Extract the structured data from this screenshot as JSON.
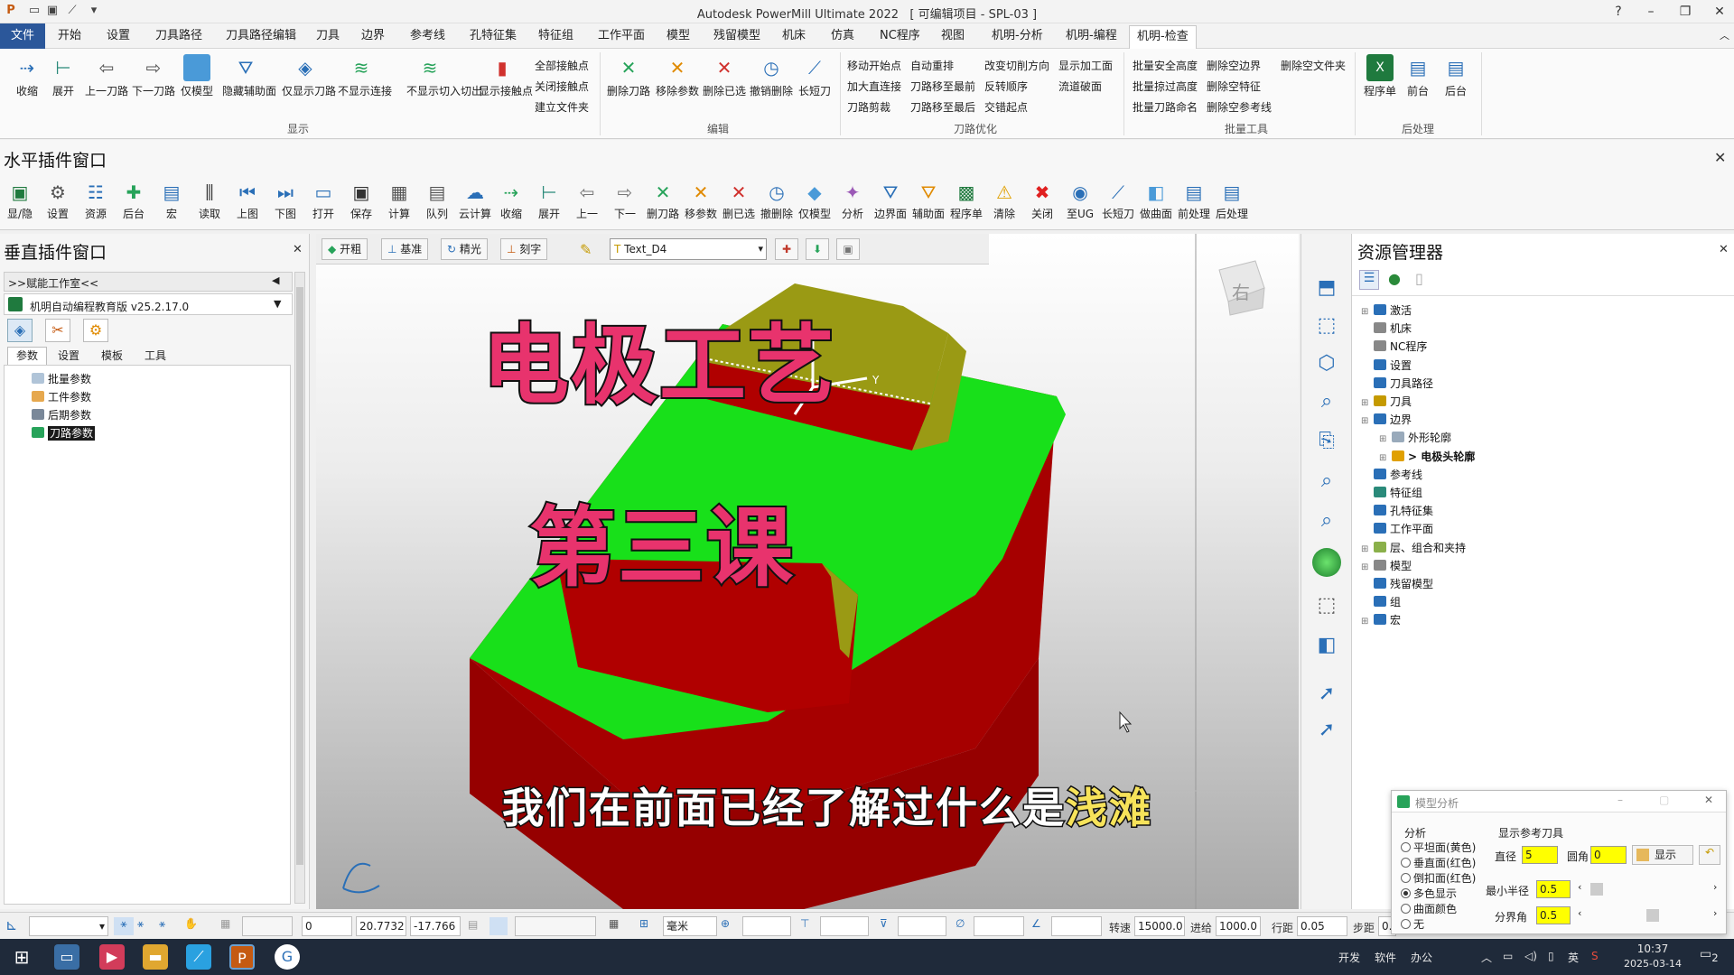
{
  "app": {
    "title": "Autodesk PowerMill Ultimate 2022",
    "project": "[ 可编辑项目 - SPL-03 ]"
  },
  "menu": [
    "文件",
    "开始",
    "设置",
    "刀具路径",
    "刀具路径编辑",
    "刀具",
    "边界",
    "参考线",
    "孔特征集",
    "特征组",
    "工作平面",
    "模型",
    "残留模型",
    "机床",
    "NC程序",
    "仿真",
    "视图",
    "机明-分析",
    "机明-编程",
    "机明-检查"
  ],
  "ribbon": {
    "display_buttons": [
      "收缩",
      "展开",
      "上一刀路",
      "下一刀路",
      "仅模型",
      "隐藏辅助面",
      "仅显示刀路",
      "不显示连接",
      "不显示切入切出",
      "显示接触点"
    ],
    "display_small": [
      "全部接触点",
      "关闭接触点",
      "建立文件夹"
    ],
    "edit_buttons": [
      "删除刀路",
      "移除参数",
      "删除已选",
      "撤销删除",
      "长短刀"
    ],
    "optimize_small": [
      "移动开始点",
      "自动重排",
      "改变切削方向",
      "显示加工面",
      "加大直连接",
      "刀路移至最前",
      "反转顺序",
      "流道破面",
      "刀路剪裁",
      "刀路移至最后",
      "交错起点"
    ],
    "batch_small": [
      "批量安全高度",
      "删除空边界",
      "删除空文件夹",
      "批量掠过高度",
      "删除空特征",
      "批量刀路命名",
      "删除空参考线"
    ],
    "post_buttons": [
      "程序单",
      "前台",
      "后台"
    ],
    "groups": [
      "显示",
      "编辑",
      "刀路优化",
      "批量工具",
      "后处理"
    ]
  },
  "hplugin": {
    "title": "水平插件窗口",
    "buttons": [
      "显/隐",
      "设置",
      "资源",
      "后台",
      "宏",
      "读取",
      "上图",
      "下图",
      "打开",
      "保存",
      "计算",
      "队列",
      "云计算",
      "收缩",
      "展开",
      "上一",
      "下一",
      "删刀路",
      "移参数",
      "删已选",
      "撤删除",
      "仅模型",
      "分析",
      "边界面",
      "辅助面",
      "程序单",
      "清除",
      "关闭",
      "至UG",
      "长短刀",
      "做曲面",
      "前处理",
      "后处理"
    ]
  },
  "vplugin": {
    "title": "垂直插件窗口",
    "nav": ">>赋能工作室<<",
    "version": "机明自动编程教育版 v25.2.17.0",
    "tabs": [
      "参数",
      "设置",
      "模板",
      "工具"
    ],
    "items": [
      "批量参数",
      "工件参数",
      "后期参数",
      "刀路参数"
    ]
  },
  "viewport": {
    "toolbar": [
      "开粗",
      "基准",
      "精光",
      "刻字"
    ],
    "dropdown": "Text_D4",
    "cube_label": "右",
    "axis_label": "Y",
    "overlay_title": "电极工艺",
    "overlay_lesson": "第三课",
    "subtitle_main": "我们在前面已经了解过什么是",
    "subtitle_highlight": "浅滩"
  },
  "explorer": {
    "title": "资源管理器",
    "tree": [
      "激活",
      "机床",
      "NC程序",
      "设置",
      "刀具路径",
      "刀具",
      "边界",
      "外形轮廓",
      "> 电极头轮廓",
      "参考线",
      "特征组",
      "孔特征集",
      "工作平面",
      "层、组合和夹持",
      "模型",
      "残留模型",
      "组",
      "宏"
    ]
  },
  "analysis": {
    "title": "模型分析",
    "group": "分析",
    "options": [
      "平坦面(黄色)",
      "垂直面(红色)",
      "倒扣面(红色)",
      "多色显示",
      "曲面颜色",
      "无"
    ],
    "ref_label": "显示参考刀具",
    "diameter_label": "直径",
    "diameter": "5",
    "corner_label": "圆角",
    "corner": "0",
    "show_button": "显示",
    "min_radius_label": "最小半径",
    "min_radius": "0.5",
    "angle_label": "分界角",
    "angle": "0.5"
  },
  "status": {
    "v1": "0",
    "v2": "20.7732",
    "v3": "-17.766",
    "unit": "毫米",
    "speed_label": "转速",
    "speed": "15000.0",
    "feed_label": "进给",
    "feed": "1000.0",
    "step_label": "行距",
    "step": "0.05",
    "stepdown_label": "步距",
    "stepdown": "0."
  },
  "taskbar": {
    "tray": [
      "开发",
      "软件",
      "办公",
      "英"
    ],
    "time": "10:37",
    "date": "2025-03-14",
    "notif": "2"
  }
}
